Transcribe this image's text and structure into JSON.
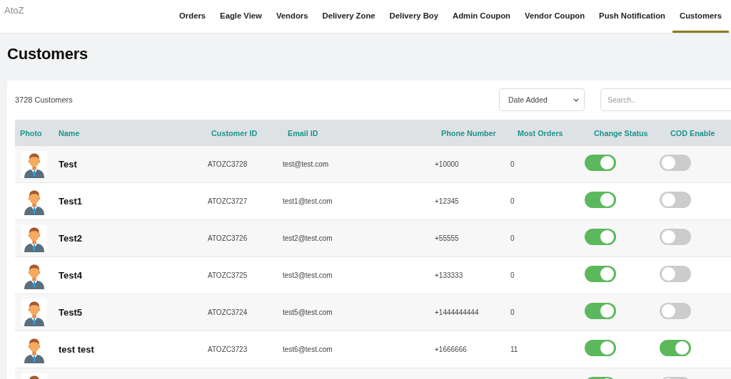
{
  "header": {
    "brand": "AtoZ",
    "nav": [
      {
        "label": "Orders",
        "selected": false
      },
      {
        "label": "Eagle View",
        "selected": false
      },
      {
        "label": "Vendors",
        "selected": false
      },
      {
        "label": "Delivery Zone",
        "selected": false
      },
      {
        "label": "Delivery Boy",
        "selected": false
      },
      {
        "label": "Admin Coupon",
        "selected": false
      },
      {
        "label": "Vendor Coupon",
        "selected": false
      },
      {
        "label": "Push Notification",
        "selected": false
      },
      {
        "label": "Customers",
        "selected": true
      }
    ]
  },
  "page": {
    "title": "Customers"
  },
  "toolbar": {
    "count": "3728 Customers",
    "sort": {
      "value": "Date Added"
    },
    "search": {
      "placeholder": "Search.."
    }
  },
  "table": {
    "columns": [
      "Photo",
      "Name",
      "Customer ID",
      "Email ID",
      "Phone Number",
      "Most Orders",
      "Change Status",
      "COD Enable"
    ],
    "rows": [
      {
        "name": "Test",
        "customer_id": "ATOZC3728",
        "email": "test@test.com",
        "phone": "+10000",
        "most_orders": "0",
        "status_on": true,
        "cod_enabled": false
      },
      {
        "name": "Test1",
        "customer_id": "ATOZC3727",
        "email": "test1@test.com",
        "phone": "+12345",
        "most_orders": "0",
        "status_on": true,
        "cod_enabled": false
      },
      {
        "name": "Test2",
        "customer_id": "ATOZC3726",
        "email": "test2@test.com",
        "phone": "+55555",
        "most_orders": "0",
        "status_on": true,
        "cod_enabled": false
      },
      {
        "name": "Test4",
        "customer_id": "ATOZC3725",
        "email": "test3@test.com",
        "phone": "+133333",
        "most_orders": "0",
        "status_on": true,
        "cod_enabled": false
      },
      {
        "name": "Test5",
        "customer_id": "ATOZC3724",
        "email": "test5@test.com",
        "phone": "+1444444444",
        "most_orders": "0",
        "status_on": true,
        "cod_enabled": false
      },
      {
        "name": "test test",
        "customer_id": "ATOZC3723",
        "email": "test6@test.com",
        "phone": "+1666666",
        "most_orders": "11",
        "status_on": true,
        "cod_enabled": true
      },
      {
        "status_on": true,
        "cod_enabled": false
      }
    ]
  }
}
